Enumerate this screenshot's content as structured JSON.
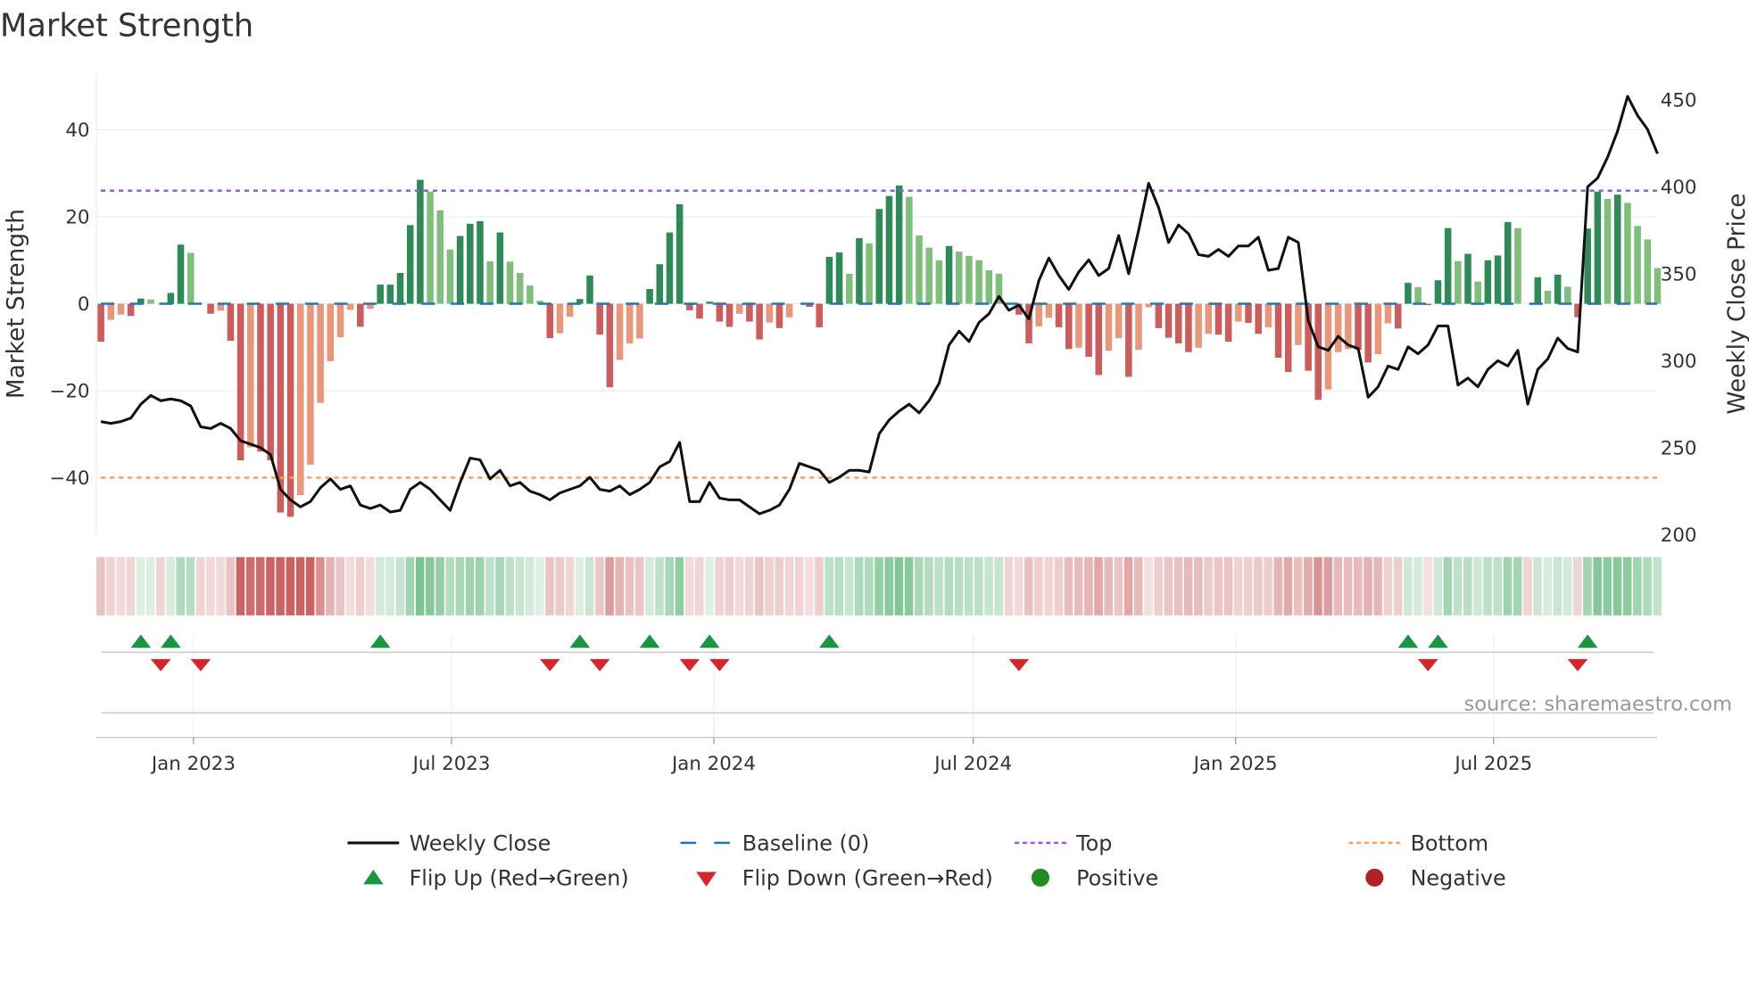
{
  "chart_data": {
    "type": "bar+line",
    "title": "Market Strength",
    "ylabel_left": "Market Strength",
    "ylabel_right": "Weekly Close Price",
    "ylim_left": [
      -53,
      53
    ],
    "ylim_right": [
      200,
      450
    ],
    "yticks_left": [
      40,
      20,
      0,
      -20,
      -40
    ],
    "yticks_left_labels": [
      "40",
      "20",
      "0",
      "−20",
      "−40"
    ],
    "yticks_right": [
      450,
      400,
      350,
      300,
      250,
      200
    ],
    "yticks_right_labels": [
      "450",
      "400",
      "350",
      "300",
      "250",
      "200"
    ],
    "x_start": "2022-10-28",
    "x_step_days": 7,
    "xticks": [
      {
        "date": "2023-01-01",
        "label": "Jan 2023"
      },
      {
        "date": "2023-07-01",
        "label": "Jul 2023"
      },
      {
        "date": "2024-01-01",
        "label": "Jan 2024"
      },
      {
        "date": "2024-07-01",
        "label": "Jul 2024"
      },
      {
        "date": "2025-01-01",
        "label": "Jan 2025"
      },
      {
        "date": "2025-07-01",
        "label": "Jul 2025"
      }
    ],
    "top_level": 26,
    "bottom_level": -40,
    "baseline": 0,
    "grid": true,
    "strength": [
      -8.7,
      -3.7,
      -2.5,
      -2.8,
      1.2,
      1.0,
      0,
      2.5,
      13.6,
      11.7,
      0,
      -2.3,
      -1.6,
      -8.5,
      -36,
      -33,
      -34,
      -36,
      -48,
      -49,
      -44,
      -37,
      -22.8,
      -13.2,
      -7.7,
      -1.4,
      -5.3,
      -1.2,
      4.4,
      4.4,
      7.1,
      18.1,
      28.5,
      25.8,
      21.5,
      12.5,
      15.6,
      18.4,
      19.0,
      9.8,
      16.4,
      9.7,
      7.1,
      4.2,
      0.7,
      -7.9,
      -6.8,
      -3.0,
      1.1,
      6.5,
      -7.1,
      -19.2,
      -12.9,
      -9.1,
      -8.0,
      3.4,
      9.1,
      16.4,
      22.9,
      -1.5,
      -3.4,
      0.5,
      -4.1,
      -5.3,
      -2.3,
      -4.1,
      -8.2,
      -4.3,
      -5.6,
      -3.1,
      0,
      -0.7,
      -5.4,
      10.8,
      11.8,
      6.9,
      15.1,
      13.9,
      21.8,
      24.8,
      27.2,
      24.6,
      15.7,
      12.9,
      10.0,
      13.3,
      12.0,
      11.0,
      10.0,
      7.7,
      6.9,
      0,
      -2.5,
      -9.1,
      -5.2,
      -3.2,
      -5.4,
      -10.4,
      -10.1,
      -12.2,
      -16.4,
      -10.8,
      -7.9,
      -16.8,
      -10.6,
      -0.8,
      -5.6,
      -7.8,
      -9.1,
      -11.1,
      -10.1,
      -6.9,
      -7.1,
      -8.7,
      -4.1,
      -4.4,
      -6.9,
      -5.4,
      -12.4,
      -15.7,
      -9.5,
      -15.4,
      -22.1,
      -19.7,
      -11.1,
      -10.4,
      -10.6,
      -13.5,
      -11.6,
      -4.5,
      -5.7,
      4.8,
      3.8,
      -0.3,
      5.4,
      17.4,
      9.8,
      11.5,
      5.1,
      10.0,
      11.1,
      18.8,
      17.4,
      0,
      6.1,
      3.0,
      6.7,
      3.9,
      -3.1,
      17.3,
      25.8,
      24.1,
      25.1,
      23.2,
      17.9,
      14.8,
      8.2
    ],
    "weekly_close": [
      265,
      264,
      265,
      267,
      275,
      280,
      277,
      278,
      277,
      274,
      262,
      261,
      264,
      261,
      254,
      252,
      250,
      246,
      226,
      220,
      216,
      219,
      227,
      232,
      226,
      228,
      217,
      215,
      217,
      213,
      214,
      226,
      230,
      226,
      220,
      214,
      230,
      244,
      243,
      232,
      237,
      228,
      230,
      225,
      223,
      220,
      224,
      226,
      228,
      233,
      226,
      225,
      228,
      223,
      226,
      230,
      239,
      242,
      253,
      219,
      219,
      230,
      221,
      220,
      220,
      216,
      212,
      214,
      217,
      226,
      241,
      239,
      237,
      230,
      233,
      237,
      237,
      236,
      258,
      266,
      271,
      275,
      270,
      277,
      287,
      309,
      317,
      311,
      322,
      327,
      337,
      329,
      332,
      324,
      346,
      359,
      349,
      341,
      351,
      358,
      349,
      353,
      372,
      350,
      375,
      402,
      388,
      368,
      378,
      373,
      361,
      360,
      364,
      360,
      366,
      366,
      371,
      352,
      353,
      371,
      368,
      323,
      308,
      306,
      314,
      309,
      307,
      279,
      285,
      297,
      295,
      308,
      304,
      309,
      320,
      320,
      286,
      290,
      285,
      295,
      300,
      297,
      306,
      275,
      295,
      301,
      313,
      307,
      305,
      400,
      405,
      417,
      432,
      452,
      441,
      433,
      419
    ],
    "flip_up_weeks": [
      4,
      7,
      28,
      48,
      55,
      61,
      73,
      131,
      134,
      149
    ],
    "flip_down_weeks": [
      6,
      10,
      45,
      50,
      59,
      62,
      92,
      133,
      148
    ],
    "colors": {
      "pos_rising": "#2e8b57",
      "pos_falling": "#7fbf7b",
      "neg_falling": "#cd5c5c",
      "neg_rising": "#e9967a",
      "line": "#111111",
      "baseline": "#1f77b4",
      "top": "#9b59d6",
      "bottom": "#f4a261",
      "flip_up": "#1a9641",
      "flip_down": "#d7262b",
      "positive": "#228b22",
      "negative": "#b22222"
    },
    "legend": [
      {
        "label": "Weekly Close",
        "symbol": "line"
      },
      {
        "label": "Baseline (0)",
        "symbol": "dash"
      },
      {
        "label": "Top",
        "symbol": "dot-purple"
      },
      {
        "label": "Bottom",
        "symbol": "dot-orange"
      },
      {
        "label": "Flip Up (Red→Green)",
        "symbol": "tri-up"
      },
      {
        "label": "Flip Down (Green→Red)",
        "symbol": "tri-down"
      },
      {
        "label": "Positive",
        "symbol": "circle-green"
      },
      {
        "label": "Negative",
        "symbol": "circle-red"
      }
    ],
    "legend_position": "bottom-center",
    "source": "source: sharemaestro.com"
  }
}
